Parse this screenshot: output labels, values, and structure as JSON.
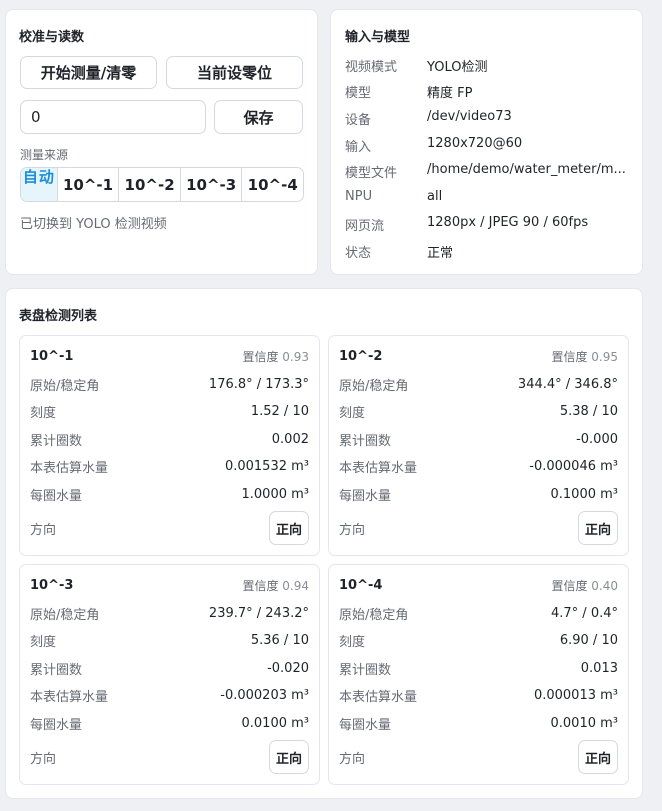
{
  "calibration": {
    "title": "校准与读数",
    "start_button": "开始测量/清零",
    "zero_button": "当前设零位",
    "value_input": "0",
    "save_button": "保存",
    "source_label": "测量来源",
    "sources": [
      "自动",
      "10^-1",
      "10^-2",
      "10^-3",
      "10^-4"
    ],
    "active_source": "自动",
    "status": "已切换到 YOLO 检测视频"
  },
  "model": {
    "title": "输入与模型",
    "rows": [
      {
        "key": "视频模式",
        "value": "YOLO检测"
      },
      {
        "key": "模型",
        "value": "精度 FP"
      },
      {
        "key": "设备",
        "value": "/dev/video73"
      },
      {
        "key": "输入",
        "value": "1280x720@60"
      },
      {
        "key": "模型文件",
        "value": "/home/demo/water_meter/m..."
      },
      {
        "key": "NPU",
        "value": "all"
      },
      {
        "key": "网页流",
        "value": "1280px / JPEG 90 / 60fps"
      },
      {
        "key": "状态",
        "value": "正常"
      }
    ]
  },
  "dials": {
    "title": "表盘检测列表",
    "confidence_label": "置信度",
    "row_labels": [
      "原始/稳定角",
      "刻度",
      "累计圈数",
      "本表估算水量",
      "每圈水量"
    ],
    "direction_label": "方向",
    "cards": [
      {
        "name": "10^-1",
        "confidence": "0.93",
        "values": [
          "176.8° / 173.3°",
          "1.52 / 10",
          "0.002",
          "0.001532 m³",
          "1.0000 m³"
        ],
        "direction": "正向"
      },
      {
        "name": "10^-2",
        "confidence": "0.95",
        "values": [
          "344.4° / 346.8°",
          "5.38 / 10",
          "-0.000",
          "-0.000046 m³",
          "0.1000 m³"
        ],
        "direction": "正向"
      },
      {
        "name": "10^-3",
        "confidence": "0.94",
        "values": [
          "239.7° / 243.2°",
          "5.36 / 10",
          "-0.020",
          "-0.000203 m³",
          "0.0100 m³"
        ],
        "direction": "正向"
      },
      {
        "name": "10^-4",
        "confidence": "0.40",
        "values": [
          "4.7° / 0.4°",
          "6.90 / 10",
          "0.013",
          "0.000013 m³",
          "0.0010 m³"
        ],
        "direction": "正向"
      }
    ]
  },
  "colors": {
    "accent": "#1a8fd6",
    "accent_bg": "#e6f4fc",
    "panel_bg": "#ffffff",
    "page_bg": "#eef0f4"
  }
}
